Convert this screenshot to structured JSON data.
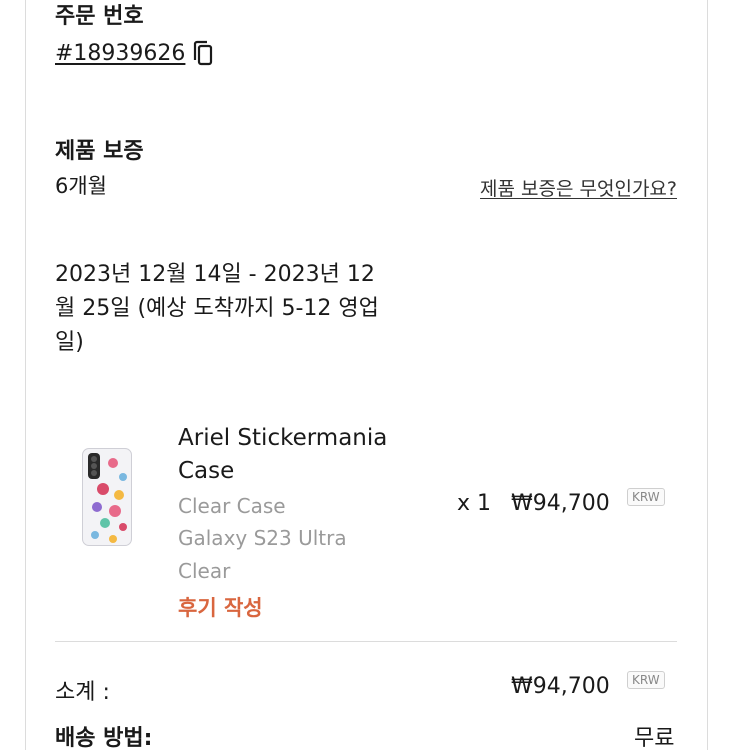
{
  "order": {
    "heading": "주문 번호",
    "number": "#18939626",
    "copy_icon": "copy-icon"
  },
  "warranty": {
    "heading": "제품 보증",
    "value": "6개월",
    "link": "제품 보증은 무엇인가요?"
  },
  "delivery": {
    "text": "2023년 12월 14일 - 2023년 12월 25일 (예상 도착까지 5-12 영업일)"
  },
  "item": {
    "name": "Ariel Stickermania Case",
    "variant_type": "Clear Case",
    "variant_model": "Galaxy S23 Ultra",
    "variant_color": "Clear",
    "review_label": "후기 작성",
    "quantity": "x 1",
    "price": "₩94,700",
    "currency": "KRW"
  },
  "summary": {
    "subtotal_label": "소계 :",
    "subtotal_value": "₩94,700",
    "currency": "KRW",
    "shipping_label_partial": "배송 방법:",
    "shipping_value_partial": "무료"
  },
  "colors": {
    "accent": "#d9663f",
    "muted_text": "#9a9a9a",
    "divider": "#dcdcdc"
  }
}
